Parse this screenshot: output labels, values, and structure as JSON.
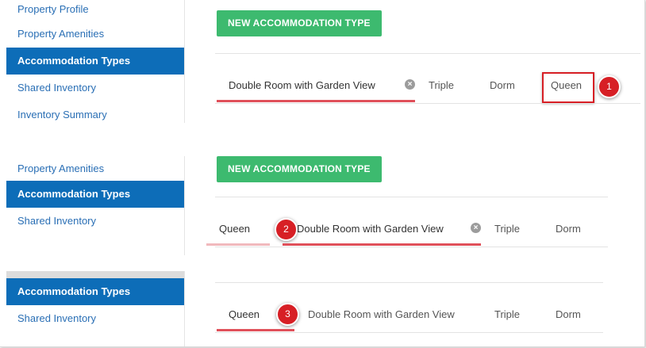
{
  "panel1": {
    "sidebar": [
      "Property Profile",
      "Property Amenities",
      "Accommodation Types",
      "Shared Inventory",
      "Inventory Summary"
    ],
    "new_button": "NEW ACCOMMODATION TYPE",
    "tabs": [
      "Double Room with Garden View",
      "Triple",
      "Dorm",
      "Queen"
    ],
    "step": "1"
  },
  "panel2": {
    "sidebar": [
      "Property Amenities",
      "Accommodation Types",
      "Shared Inventory"
    ],
    "new_button": "NEW ACCOMMODATION TYPE",
    "tabs": [
      "Queen",
      "Double Room with Garden View",
      "Triple",
      "Dorm"
    ],
    "step": "2"
  },
  "panel3": {
    "sidebar": [
      "Accommodation Types",
      "Shared Inventory"
    ],
    "tabs": [
      "Queen",
      "Double Room with Garden View",
      "Triple",
      "Dorm"
    ],
    "step": "3"
  },
  "colors": {
    "accent_blue": "#0d6db8",
    "button_green": "#3dba6f",
    "tab_underline": "#e0505a",
    "callout_red": "#d71f25"
  }
}
